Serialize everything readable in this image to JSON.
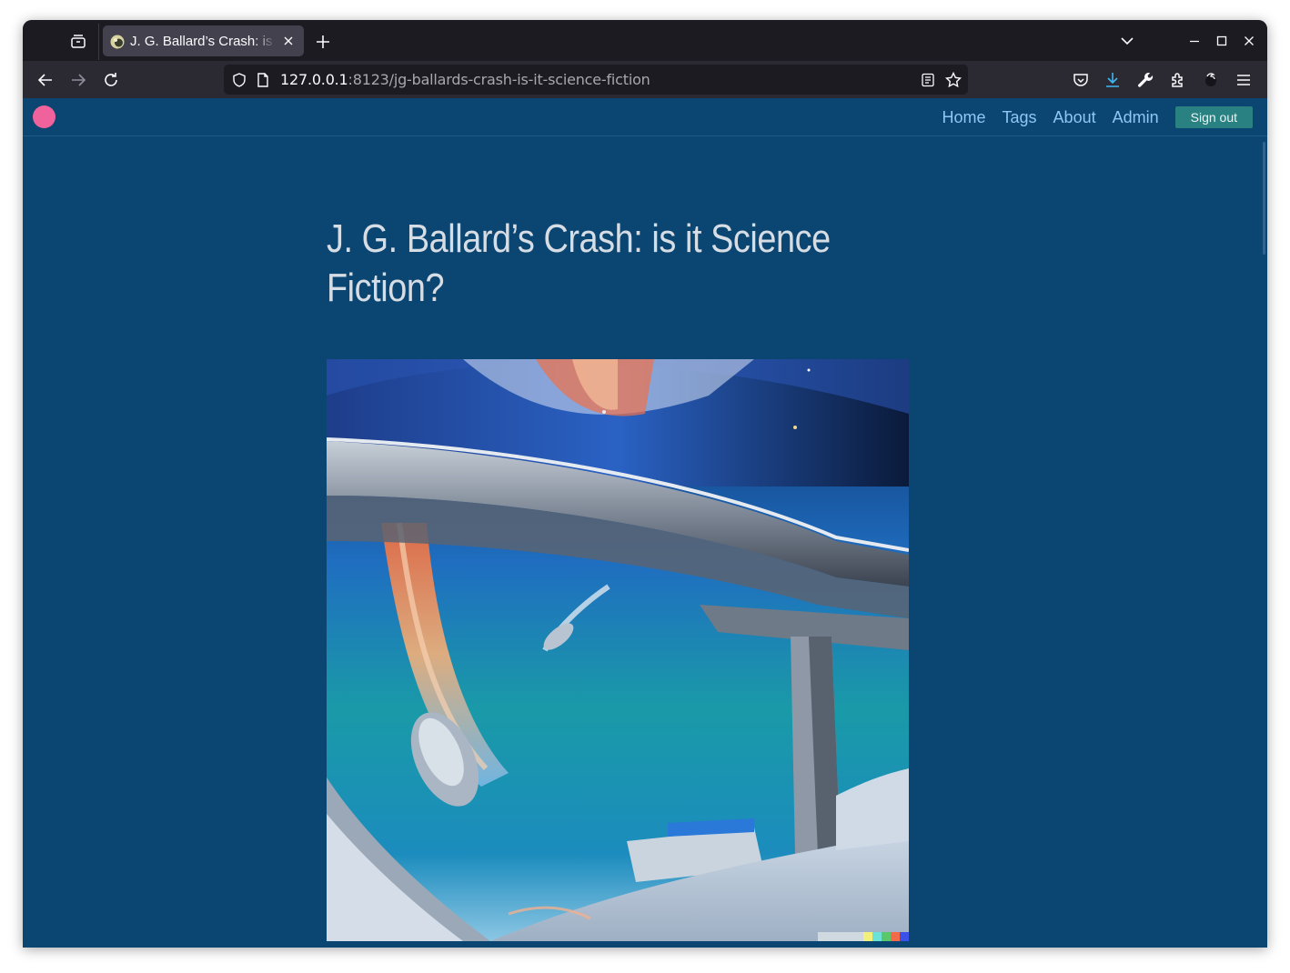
{
  "browser": {
    "tab": {
      "title": "J. G. Ballard’s Crash: is it Science Fiction?"
    },
    "url": {
      "host": "127.0.0.1",
      "rest": ":8123/jg-ballards-crash-is-it-science-fiction"
    }
  },
  "site": {
    "nav": {
      "home": "Home",
      "tags": "Tags",
      "about": "About",
      "admin": "Admin",
      "sign_out": "Sign out"
    },
    "colors": {
      "background": "#0b4572",
      "logo": "#f0629b",
      "nav_link": "#8fc6f2",
      "sign_out_button": "#2a8182"
    }
  },
  "post": {
    "title": "J. G. Ballard’s Crash: is it Science Fiction?"
  }
}
